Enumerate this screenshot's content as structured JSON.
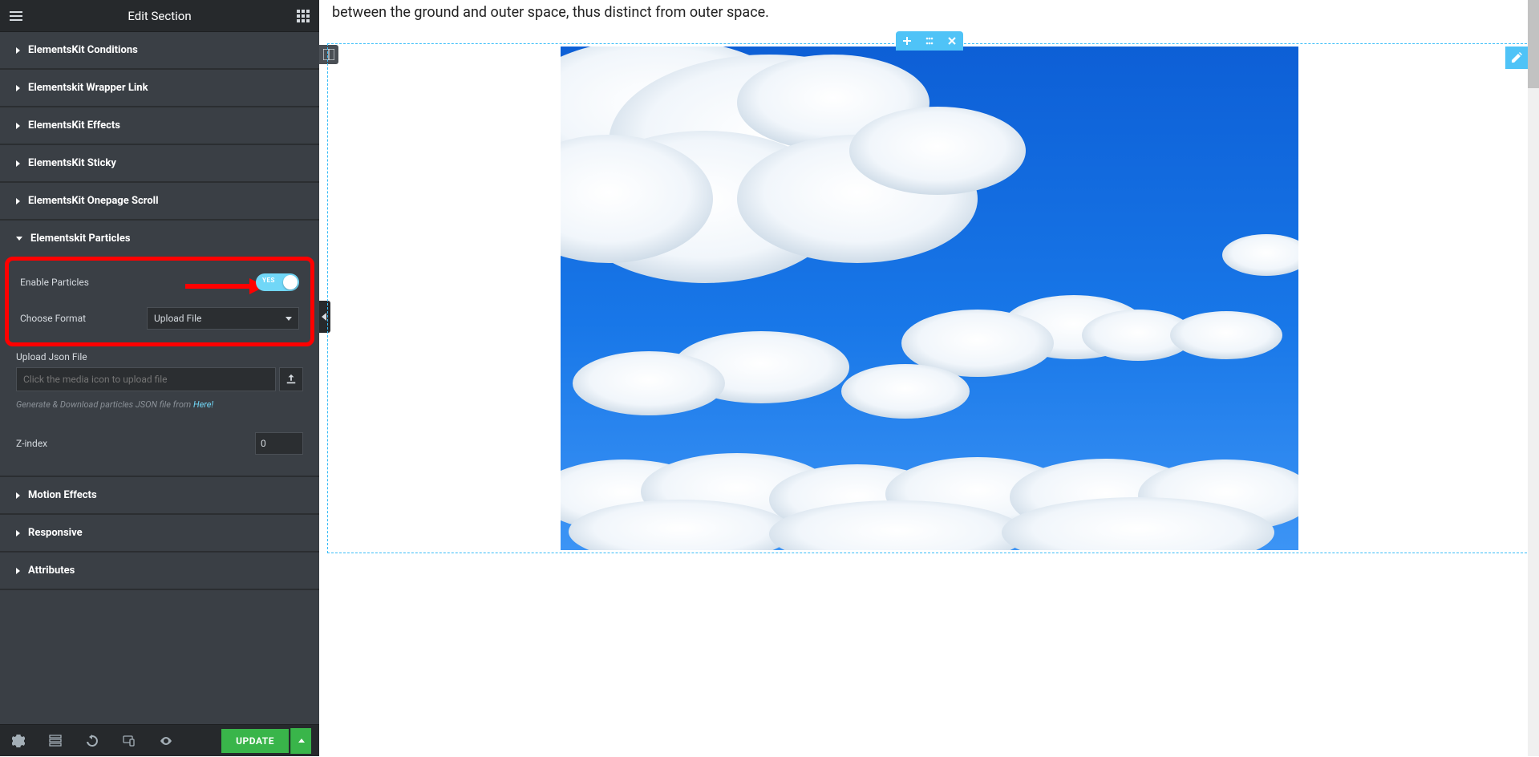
{
  "panel": {
    "title": "Edit Section",
    "acc": [
      {
        "label": "ElementsKit Conditions",
        "open": false
      },
      {
        "label": "Elementskit Wrapper Link",
        "open": false
      },
      {
        "label": "ElementsKit Effects",
        "open": false
      },
      {
        "label": "ElementsKit Sticky",
        "open": false
      },
      {
        "label": "ElementsKit Onepage Scroll",
        "open": false
      },
      {
        "label": "Elementskit Particles",
        "open": true
      },
      {
        "label": "Motion Effects",
        "open": false
      },
      {
        "label": "Responsive",
        "open": false
      },
      {
        "label": "Attributes",
        "open": false
      }
    ],
    "particles": {
      "enable_label": "Enable Particles",
      "toggle_text": "YES",
      "format_label": "Choose Format",
      "format_value": "Upload File",
      "json_label": "Upload Json File",
      "json_placeholder": "Click the media icon to upload file",
      "hint_prefix": "Generate & Download particles JSON file from ",
      "hint_link": "Here!",
      "zindex_label": "Z-index",
      "zindex_value": "0"
    },
    "footer": {
      "update": "UPDATE"
    }
  },
  "canvas": {
    "intro": "between the ground and outer space, thus distinct from outer space."
  }
}
